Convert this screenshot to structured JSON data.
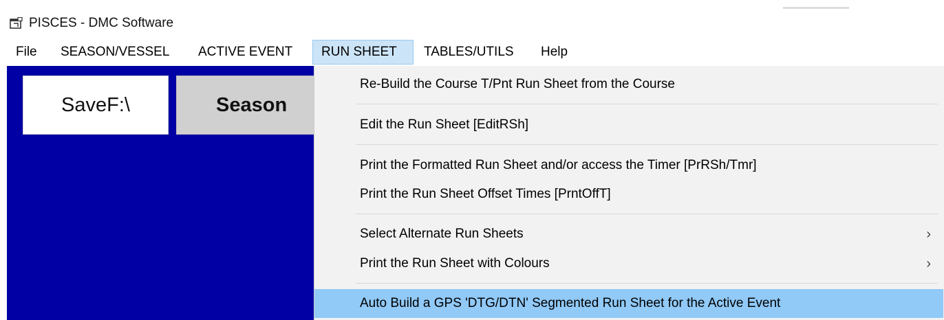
{
  "window": {
    "title": "PISCES - DMC Software",
    "icon": "app-window-icon"
  },
  "menubar": {
    "items": [
      {
        "label": "File"
      },
      {
        "label": "SEASON/VESSEL"
      },
      {
        "label": "ACTIVE EVENT"
      },
      {
        "label": "RUN SHEET",
        "active": true
      },
      {
        "label": "TABLES/UTILS"
      },
      {
        "label": "Help"
      }
    ]
  },
  "workspace": {
    "background": "#0000a4",
    "buttons": [
      {
        "label": "SaveF:\\"
      },
      {
        "label": "Season"
      }
    ]
  },
  "run_sheet_menu": {
    "highlight_color": "#91c9f7",
    "items": [
      {
        "label": "Re-Build the Course T/Pnt Run Sheet from the Course"
      },
      {
        "label": "Edit the Run Sheet  [EditRSh]"
      },
      {
        "label": "Print the Formatted Run Sheet and/or access the Timer  [PrRSh/Tmr]"
      },
      {
        "label": "Print the Run Sheet Offset Times  [PrntOffT]"
      },
      {
        "label": "Select Alternate Run Sheets",
        "submenu": true,
        "icon": "chevron-right-icon"
      },
      {
        "label": "Print the Run Sheet with Colours",
        "submenu": true,
        "icon": "chevron-right-icon"
      },
      {
        "label": "Auto Build a GPS 'DTG/DTN' Segmented Run Sheet for the Active Event",
        "highlighted": true
      }
    ],
    "chevron_glyph": "›"
  }
}
